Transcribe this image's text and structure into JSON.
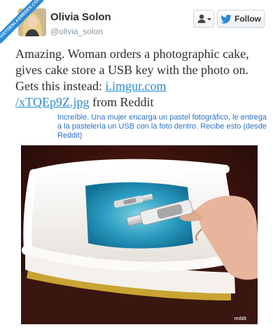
{
  "ribbon": {
    "text": "VISTOENLASREDES.COM"
  },
  "profile": {
    "name": "Olivia Solon",
    "handle": "@olivia_solon"
  },
  "buttons": {
    "follow_label": "Follow",
    "follow_icon": "twitter-bird-icon",
    "user_menu_icon": "user-dropdown-icon"
  },
  "tweet": {
    "text_before": "Amazing. Woman orders a photographic cake, gives cake store a USB key with the photo on. Gets this instead: ",
    "link_line1": "i.imgur.com",
    "link_line2": "/xTQEp9Z.jpg",
    "text_after": " from Reddit"
  },
  "translation": "Increíble. Una mujer encarga un pastel fotográfico, le entrega a la pastelería un USB con la foto dentro. Recibe esto (desde Reddit)",
  "photo": {
    "watermark": "reddit"
  },
  "colors": {
    "accent": "#2a8bd6",
    "translation_text": "#2a6fc9",
    "name_text": "#292f33",
    "handle_text": "#8899a6"
  }
}
